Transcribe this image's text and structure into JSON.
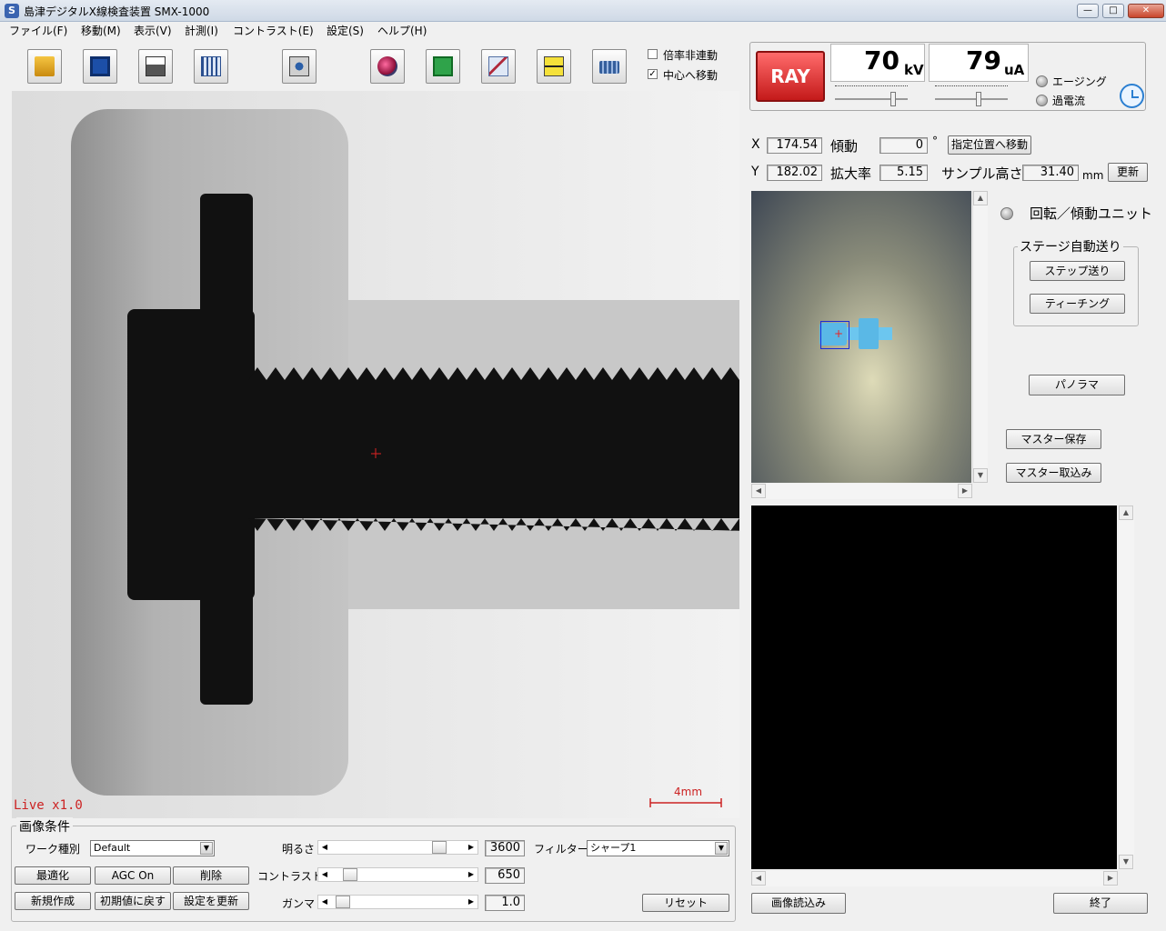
{
  "window": {
    "app_icon": "S",
    "title": "島津デジタルX線検査装置 SMX-1000",
    "controls": [
      "minimize-icon",
      "maximize-icon",
      "close-icon"
    ]
  },
  "menu": [
    "ファイル(F)",
    "移動(M)",
    "表示(V)",
    "計測(I)",
    "コントラスト(E)",
    "設定(S)",
    "ヘルプ(H)"
  ],
  "toolbar": {
    "buttons": [
      "open-folder-icon",
      "save-icon",
      "print-icon",
      "grid-window-icon",
      "camera-icon",
      "sphere-icon",
      "green-gear-icon",
      "cable-icon",
      "measure-arrow-icon",
      "keyboard-icon"
    ],
    "check_magnification": {
      "label": "倍率非連動",
      "checked": false
    },
    "check_center_move": {
      "label": "中心へ移動",
      "checked": true
    }
  },
  "xray_view": {
    "status": "Live x1.0",
    "scale_label": "4mm"
  },
  "xray_panel": {
    "ray_button_label": "RAY",
    "kv_value": "70",
    "kv_unit": "kV",
    "ua_value": "79",
    "ua_unit": "uA",
    "aging_label": "エージング",
    "overcurrent_label": "過電流"
  },
  "stage": {
    "x_label": "X",
    "x_value": "174.54",
    "y_label": "Y",
    "y_value": "182.02",
    "tilt_label": "傾動",
    "tilt_value": "0",
    "degree_symbol": "°",
    "move_button": "指定位置へ移動",
    "mag_label": "拡大率",
    "mag_value": "5.15",
    "sample_height_label": "サンプル高さ",
    "sample_height_value": "31.40",
    "unit_mm": "mm",
    "update_button": "更新"
  },
  "right_controls": {
    "rotation_unit_label": "回転／傾動ユニット",
    "auto_feed_group": "ステージ自動送り",
    "step_button": "ステップ送り",
    "teaching_button": "ティーチング",
    "panorama_button": "パノラマ",
    "master_save_button": "マスター保存",
    "master_load_button": "マスター取込み"
  },
  "bottom_right": {
    "load_image_button": "画像読込み",
    "exit_button": "終了"
  },
  "image_conditions": {
    "group_label": "画像条件",
    "work_type_label": "ワーク種別",
    "work_type_value": "Default",
    "brightness_label": "明るさ",
    "brightness_value": "3600",
    "brightness_level": 0.85,
    "filter_label": "フィルター",
    "filter_value": "シャープ1",
    "optimize_button": "最適化",
    "agc_button": "AGC On",
    "delete_button": "削除",
    "contrast_label": "コントラスト",
    "contrast_value": "650",
    "contrast_level": 0.1,
    "new_button": "新規作成",
    "reset_default_button": "初期値に戻す",
    "update_settings_button": "設定を更新",
    "gamma_label": "ガンマ",
    "gamma_value": "1.0",
    "gamma_level": 0.04,
    "reset_button": "リセット"
  }
}
